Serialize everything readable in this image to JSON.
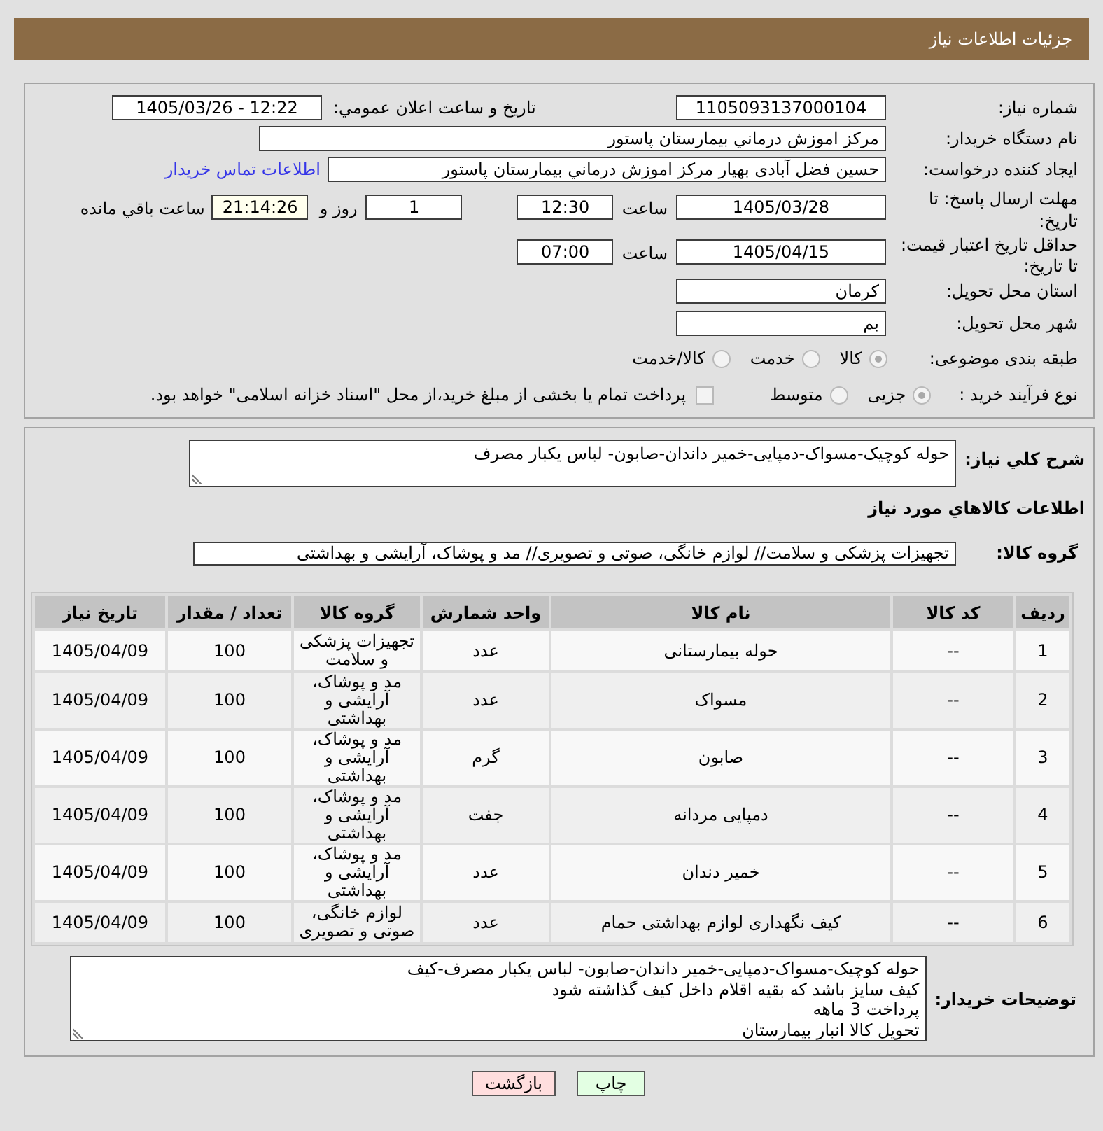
{
  "header": {
    "title": "جزئیات اطلاعات نیاز"
  },
  "details": {
    "need_number": {
      "label": "شماره نیاز:",
      "value": "1105093137000104"
    },
    "announcement": {
      "label": "تاریخ و ساعت اعلان عمومي:",
      "value": "1405/03/26 - 12:22"
    },
    "buyer_organization": {
      "label": "نام دستگاه خریدار:",
      "value": "مرکز اموزش درماني بيمارستان پاستور"
    },
    "requester": {
      "label": "ایجاد کننده درخواست:",
      "value": "حسين فضل آبادی بهيار مرکز اموزش درماني بيمارستان پاستور",
      "contact_link": "اطلاعات تماس خریدار"
    },
    "response_deadline": {
      "label": "مهلت ارسال پاسخ: تا تاریخ:",
      "date": "1405/03/28",
      "time_label": "ساعت",
      "time": "12:30",
      "days": "1",
      "days_label": "روز و",
      "remaining_time": "21:14:26",
      "remaining_label": "ساعت باقي مانده"
    },
    "price_validity": {
      "label": "حداقل تاریخ اعتبار قیمت: تا تاریخ:",
      "date": "1405/04/15",
      "time_label": "ساعت",
      "time": "07:00"
    },
    "delivery_province": {
      "label": "استان محل تحویل:",
      "value": "کرمان"
    },
    "delivery_city": {
      "label": "شهر محل تحویل:",
      "value": "بم"
    },
    "subject_category": {
      "label": "طبقه بندی موضوعی:",
      "options": [
        {
          "label": "کالا",
          "selected": true,
          "disabled": true
        },
        {
          "label": "خدمت",
          "selected": false,
          "disabled": true
        },
        {
          "label": "کالا/خدمت",
          "selected": false,
          "disabled": true
        }
      ]
    },
    "purchase_process": {
      "label": "نوع فرآیند خرید :",
      "options": [
        {
          "label": "جزیی",
          "selected": true,
          "disabled": true
        },
        {
          "label": "متوسط",
          "selected": false,
          "disabled": true
        }
      ],
      "treasury_payment": {
        "label": "پرداخت تمام یا بخشی از مبلغ خرید،از محل \"اسناد خزانه اسلامی\" خواهد بود.",
        "checked": false,
        "disabled": true
      }
    }
  },
  "needs": {
    "summary": {
      "label": "شرح کلي نیاز:",
      "value": "حوله کوچیک-مسواک-دمپایی-خمیر داندان-صابون- لباس یکبار مصرف"
    },
    "section_title": "اطلاعات کالاهاي مورد نیاز",
    "goods_group": {
      "label": "گروه کالا:",
      "value": "تجهیزات پزشکی و سلامت// لوازم خانگی، صوتی و تصویری// مد و پوشاک، آرایشی و بهداشتی"
    },
    "table": {
      "columns": [
        "ردیف",
        "کد کالا",
        "نام کالا",
        "واحد شمارش",
        "گروه کالا",
        "تعداد / مقدار",
        "تاریخ نیاز"
      ],
      "rows": [
        [
          "1",
          "--",
          "حوله بیمارستانی",
          "عدد",
          "تجهیزات پزشکی و سلامت",
          "100",
          "1405/04/09"
        ],
        [
          "2",
          "--",
          "مسواک",
          "عدد",
          "مد و پوشاک، آرایشی و بهداشتی",
          "100",
          "1405/04/09"
        ],
        [
          "3",
          "--",
          "صابون",
          "گرم",
          "مد و پوشاک، آرایشی و بهداشتی",
          "100",
          "1405/04/09"
        ],
        [
          "4",
          "--",
          "دمپایی مردانه",
          "جفت",
          "مد و پوشاک، آرایشی و بهداشتی",
          "100",
          "1405/04/09"
        ],
        [
          "5",
          "--",
          "خمیر دندان",
          "عدد",
          "مد و پوشاک، آرایشی و بهداشتی",
          "100",
          "1405/04/09"
        ],
        [
          "6",
          "--",
          "کیف نگهداری لوازم بهداشتی حمام",
          "عدد",
          "لوازم خانگی، صوتی و تصویری",
          "100",
          "1405/04/09"
        ]
      ]
    },
    "buyer_notes": {
      "label": "توضیحات خریدار:",
      "value": "حوله کوچیک-مسواک-دمپایی-خمیر داندان-صابون- لباس یکبار مصرف-کیف\nکیف سایز باشد که بقیه اقلام داخل کیف گذاشته شود\nپرداخت 3 ماهه\nتحویل کالا انبار بیمارستان"
    }
  },
  "buttons": [
    {
      "kind": "print",
      "label": "چاپ"
    },
    {
      "kind": "back",
      "label": "بازگشت"
    }
  ]
}
